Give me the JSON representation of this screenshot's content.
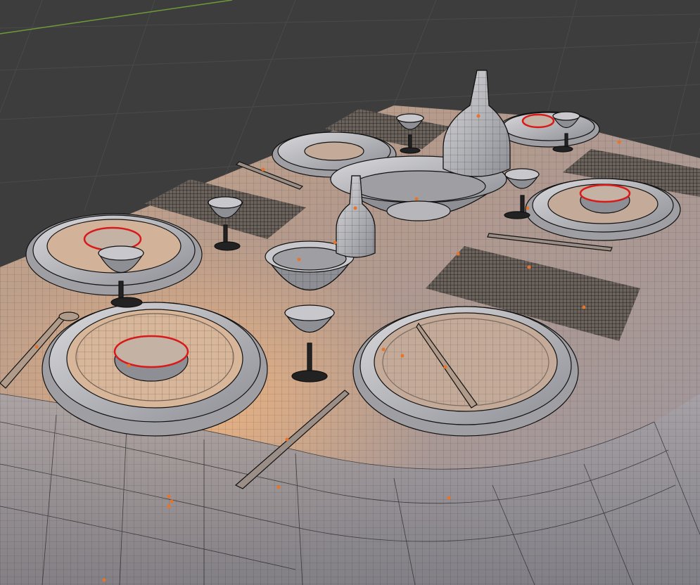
{
  "app": "3D viewport",
  "viewport": {
    "background": "#3d3d3d",
    "grid_line_color": "#4a4a4a",
    "x_axis_color": "#6f9a3a",
    "mesh_surface": "#b8a59a",
    "wire_color": "#151515",
    "seam_color": "#d81a1a",
    "origin_dot_color": "#e8742a"
  },
  "objects": [
    "tablecloth",
    "plate-set-front-left",
    "plate-front-right",
    "plate-mid-left",
    "plate-back-center",
    "plate-back-right",
    "plate-right",
    "serving-bowl",
    "bowl",
    "wine-glass-front",
    "wine-glass-left",
    "wine-glass-mid-left",
    "wine-glass-back",
    "wine-glass-back-right",
    "wine-glass-right",
    "vase-large",
    "vase-small",
    "napkin-right",
    "napkin-left",
    "napkin-back",
    "napkin-back-right",
    "knife-front",
    "knife-on-plate",
    "spoon-left",
    "fork-back-left",
    "knife-right"
  ]
}
